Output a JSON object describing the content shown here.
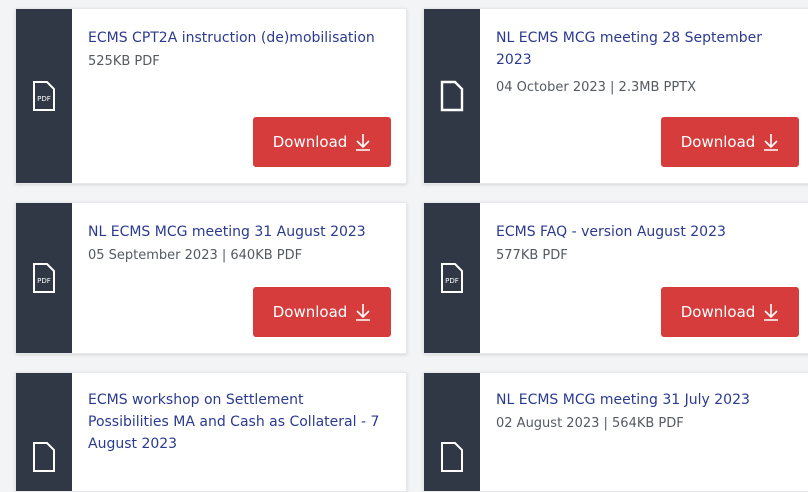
{
  "button_label": "Download",
  "cards": [
    {
      "title": "ECMS CPT2A instruction (de)mobilisation",
      "meta": "525KB PDF",
      "icon": "pdf-file-icon"
    },
    {
      "title": "NL ECMS MCG meeting 28 September 2023",
      "meta": "04 October 2023 |  2.3MB PPTX",
      "icon": "file-icon"
    },
    {
      "title": "NL ECMS MCG meeting 31 August 2023",
      "meta": "05 September 2023 |  640KB PDF",
      "icon": "pdf-file-icon"
    },
    {
      "title": "ECMS FAQ - version August 2023",
      "meta": "577KB PDF",
      "icon": "pdf-file-icon"
    },
    {
      "title": "ECMS workshop on Settlement Possibilities MA and Cash as Collateral - 7 August 2023",
      "meta": "",
      "icon": "pdf-file-icon"
    },
    {
      "title": "NL ECMS MCG meeting 31 July 2023",
      "meta": "02 August 2023 |  564KB PDF",
      "icon": "pdf-file-icon"
    }
  ]
}
